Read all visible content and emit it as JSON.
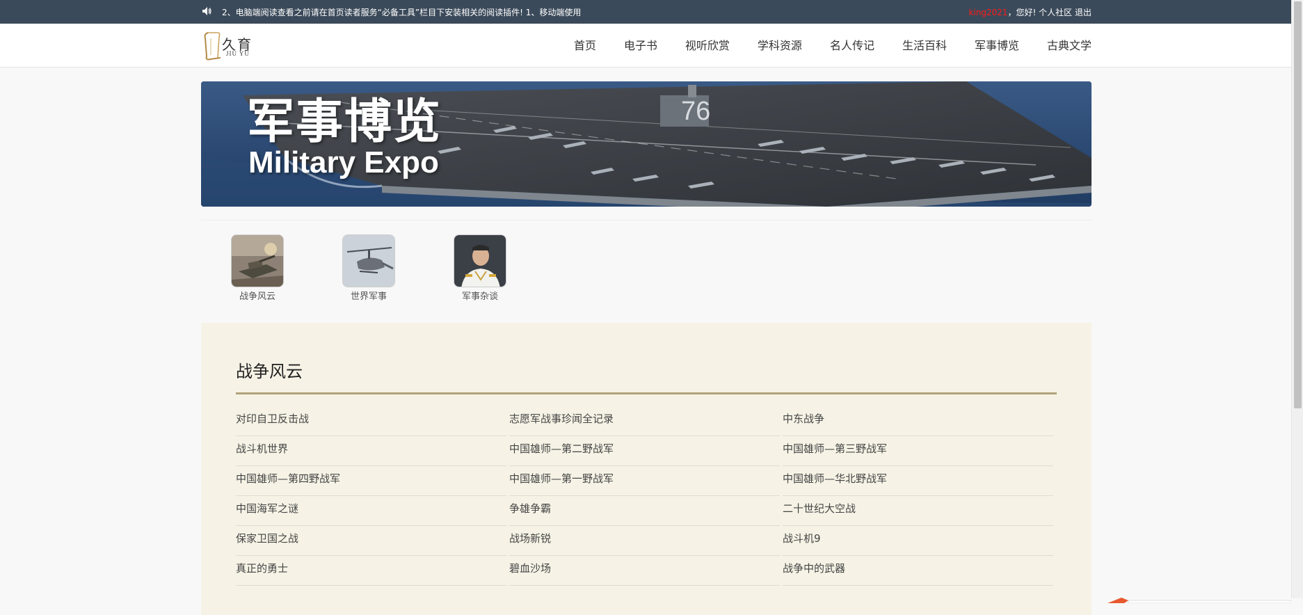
{
  "topbar": {
    "notice": "2、电脑端阅读查看之前请在首页读者服务“必备工具”栏目下安装相关的阅读插件!     1、移动端使用",
    "username": "king2021",
    "greeting": "，您好!",
    "community": "个人社区",
    "logout": "退出"
  },
  "logo": {
    "cn": "久育",
    "en": "JIU YU"
  },
  "nav": [
    {
      "label": "首页"
    },
    {
      "label": "电子书"
    },
    {
      "label": "视听欣赏"
    },
    {
      "label": "学科资源"
    },
    {
      "label": "名人传记"
    },
    {
      "label": "生活百科"
    },
    {
      "label": "军事博览"
    },
    {
      "label": "古典文学"
    }
  ],
  "banner": {
    "title": "军事博览",
    "subtitle": "Military Expo"
  },
  "categories": [
    {
      "label": "战争风云",
      "icon": "tank-photo"
    },
    {
      "label": "世界军事",
      "icon": "helicopter-photo"
    },
    {
      "label": "军事杂谈",
      "icon": "officer-photo"
    }
  ],
  "section": {
    "title": "战争风云",
    "items": [
      "对印自卫反击战",
      "志愿军战事珍闻全记录",
      "中东战争",
      "战斗机世界",
      "中国雄师—第二野战军",
      "中国雄师—第三野战军",
      "中国雄师—第四野战军",
      "中国雄师—第一野战军",
      "中国雄师—华北野战军",
      "中国海军之谜",
      "争雄争霸",
      "二十世纪大空战",
      "保家卫国之战",
      "战场新锐",
      "战斗机9",
      "真正的勇士",
      "碧血沙场",
      "战争中的武器"
    ]
  },
  "colors": {
    "topbar": "#3b4a5a",
    "panel": "#f6f3e6",
    "rule": "#b2a27a",
    "username": "#ff1a1a"
  }
}
